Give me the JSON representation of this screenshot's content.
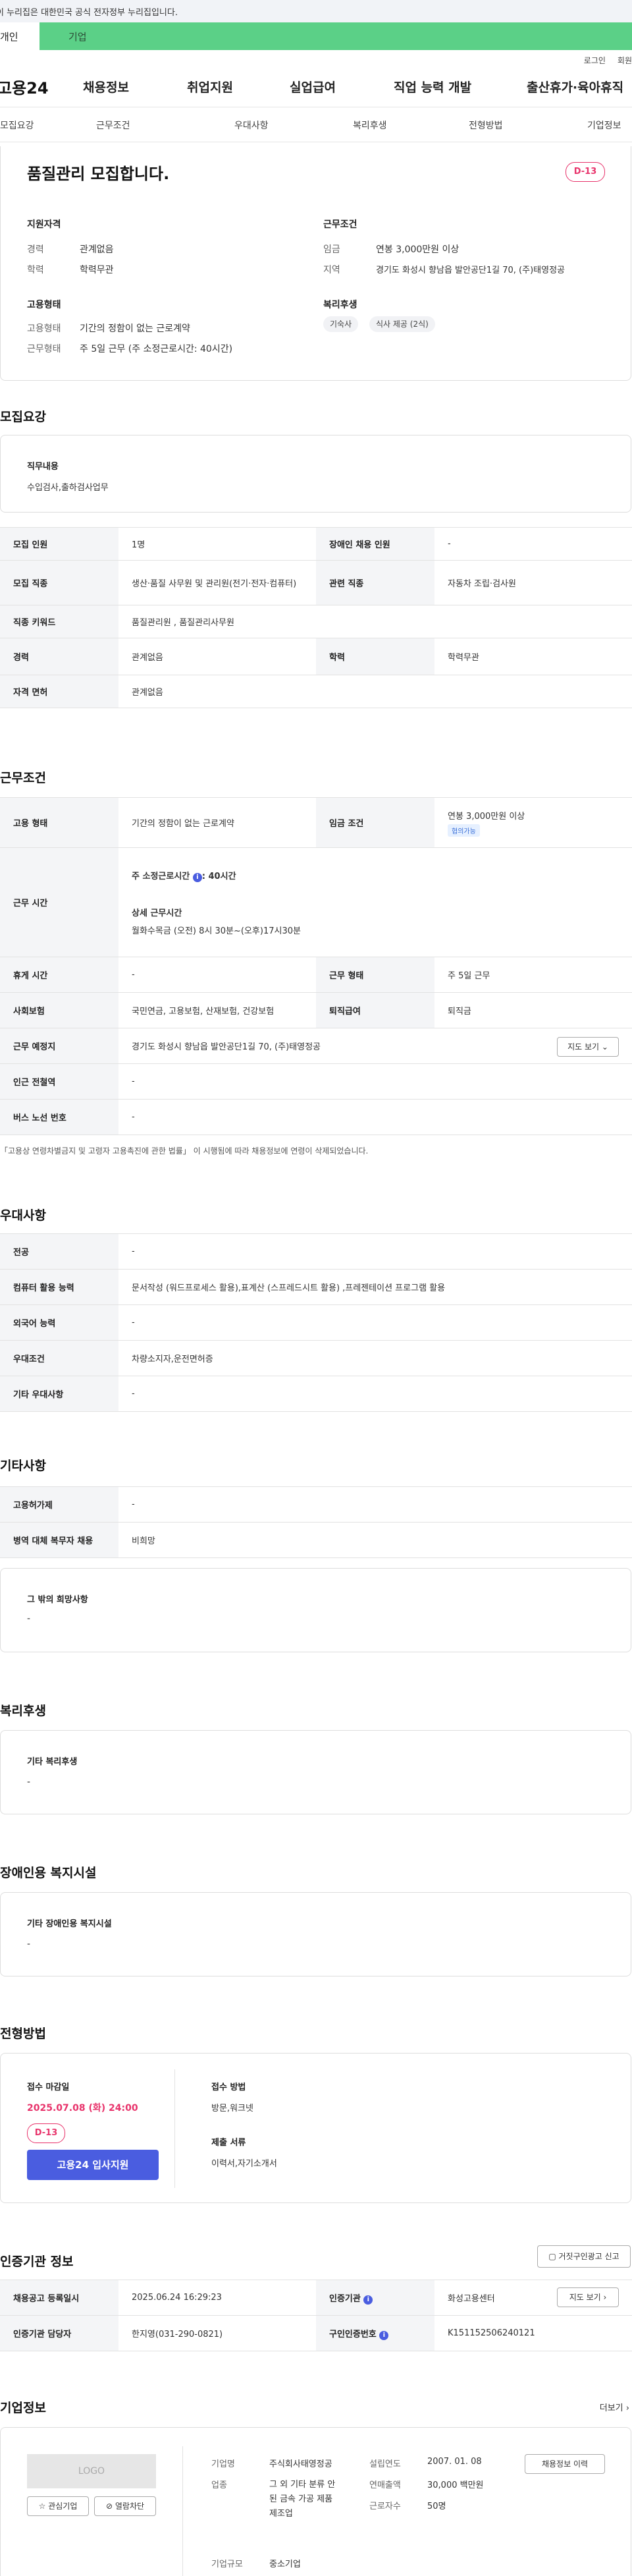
{
  "gov_banner": "이 누리집은 대한민국 공식 전자정부 누리집입니다.",
  "topbar": {
    "left": "개인",
    "right": "기업"
  },
  "util": {
    "login": "로그인",
    "join": "회원"
  },
  "gnb": {
    "logo": "고용24",
    "items": [
      "채용정보",
      "취업지원",
      "실업급여",
      "직업 능력 개발",
      "출산휴가·육아휴직"
    ]
  },
  "tabs": [
    "모집요강",
    "근무조건",
    "우대사항",
    "복리후생",
    "전형방법",
    "기업정보"
  ],
  "summary": {
    "title": "품질관리 모집합니다.",
    "dday": "D-13",
    "qual_title": "지원자격",
    "qual": [
      {
        "k": "경력",
        "v": "관계없음"
      },
      {
        "k": "학력",
        "v": "학력무관"
      }
    ],
    "cond_title": "근무조건",
    "cond": [
      {
        "k": "임금",
        "v": "연봉 3,000만원 이상"
      },
      {
        "k": "지역",
        "v": "경기도 화성시 향남읍 발안공단1길 70, (주)태영정공"
      }
    ],
    "emp_title": "고용형태",
    "emp": [
      {
        "k": "고용형태",
        "v": "기간의 정함이 없는 근로계약"
      },
      {
        "k": "근무형태",
        "v": "주 5일 근무 (주 소정근로시간: 40시간)"
      }
    ],
    "welfare_title": "복리후생",
    "welfare": [
      "기숙사",
      "식사 제공 (2식)"
    ]
  },
  "recruit": {
    "heading": "모집요강",
    "duty_label": "직무내용",
    "duty": "수입검사,출하검사업무",
    "rows": [
      {
        "k": "모집 인원",
        "v": "1명",
        "k2": "장애인 채용 인원",
        "v2": "-"
      },
      {
        "k": "모집 직종",
        "v": "생산·품질 사무원 및 관리원(전기·전자·컴퓨터)",
        "k2": "관련 직종",
        "v2": "자동차 조립·검사원"
      },
      {
        "k": "직종 키워드",
        "v": "품질관리원 , 품질관리사무원"
      },
      {
        "k": "경력",
        "v": "관계없음",
        "k2": "학력",
        "v2": "학력무관"
      },
      {
        "k": "자격 면허",
        "v": "관계없음"
      }
    ]
  },
  "work": {
    "heading": "근무조건",
    "emp_k": "고용 형태",
    "emp_v": "기간의 정함이 없는 근로계약",
    "wage_k": "임금 조건",
    "wage_v": "연봉 3,000만원 이상",
    "wage_tag": "협의가능",
    "hours_k": "근무 시간",
    "hours_weekly": "주 소정근로시간",
    "hours_weekly_v": "40시간",
    "hours_detail_label": "상세 근무시간",
    "hours_detail": "월화수목금 (오전) 8시 30분~(오후)17시30분",
    "rest_k": "휴게 시간",
    "rest_v": "-",
    "shift_k": "근무 형태",
    "shift_v": "주 5일 근무",
    "ins_k": "사회보험",
    "ins_v": "국민연금, 고용보험, 산재보험, 건강보험",
    "sev_k": "퇴직급여",
    "sev_v": "퇴직금",
    "place_k": "근무 예정지",
    "place_v": "경기도 화성시 향남읍 발안공단1길 70, (주)태영정공",
    "map_btn": "지도 보기",
    "subway_k": "인근 전철역",
    "subway_v": "-",
    "bus_k": "버스 노선 번호",
    "bus_v": "-",
    "note": "「고용상 연령차별금지 및 고령자 고용촉진에 관한 법률」 이 시행됨에 따라 채용정보에 연령이 삭제되었습니다."
  },
  "pref": {
    "heading": "우대사항",
    "rows": [
      {
        "k": "전공",
        "v": "-"
      },
      {
        "k": "컴퓨터 활용 능력",
        "v": "문서작성 (워드프로세스 활용),표계산 (스프레드시트 활용) ,프레젠테이션 프로그램 활용"
      },
      {
        "k": "외국어 능력",
        "v": "-"
      },
      {
        "k": "우대조건",
        "v": "차량소지자,운전면허증"
      },
      {
        "k": "기타 우대사항",
        "v": "-"
      }
    ]
  },
  "etc": {
    "heading": "기타사항",
    "rows": [
      {
        "k": "고용허가제",
        "v": "-"
      },
      {
        "k": "병역 대체 복무자 채용",
        "v": "비희망"
      }
    ],
    "other_label": "그 밖의 희망사항",
    "other_v": "-"
  },
  "welfare": {
    "heading": "복리후생",
    "label": "기타 복리후생",
    "v": "-"
  },
  "disabled": {
    "heading": "장애인용 복지시설",
    "label": "기타 장애인용 복지시설",
    "v": "-"
  },
  "process": {
    "heading": "전형방법",
    "deadline_label": "접수 마감일",
    "deadline": "2025.07.08 (화) 24:00",
    "dday": "D-13",
    "apply_btn": "고용24 입사지원",
    "method_label": "접수 방법",
    "method": "방문,워크넷",
    "docs_label": "제출 서류",
    "docs": "이력서,자기소개서"
  },
  "cert": {
    "heading": "인증기관 정보",
    "report_btn": "거짓구인광고 신고",
    "rows": [
      {
        "k": "채용공고 등록일시",
        "v": "2025.06.24 16:29:23",
        "k2": "인증기관",
        "v2": "화성고용센터",
        "btn": "지도 보기"
      },
      {
        "k": "인증기관 담당자",
        "v": "한지영(031-290-0821)",
        "k2": "구인인증번호",
        "v2": "K151152506240121"
      }
    ]
  },
  "company": {
    "heading": "기업정보",
    "more": "더보기",
    "logo": "LOGO",
    "fav_btn": "관심기업",
    "block_btn": "열람차단",
    "name_k": "기업명",
    "name_v": "주식회사태영정공",
    "biz_k": "업종",
    "biz_v": "그 외 기타 분류 안된 금속 가공 제품 제조업",
    "size_k": "기업규모",
    "size_v": "중소기업",
    "year_k": "설립연도",
    "year_v": "2007. 01. 08",
    "sales_k": "연매출액",
    "sales_v": "30,000 백만원",
    "emp_k": "근로자수",
    "emp_v": "50명",
    "history_btn": "채용정보 이력"
  }
}
